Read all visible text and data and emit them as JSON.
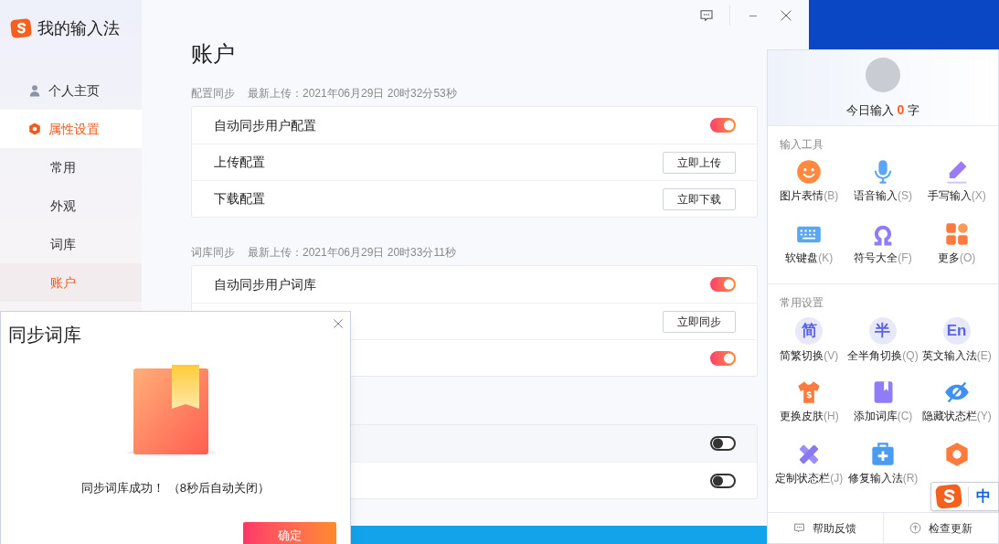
{
  "app": {
    "title": "我的输入法"
  },
  "title_bar": {
    "buttons": [
      {
        "kind": "feedback"
      },
      {
        "kind": "minimize"
      },
      {
        "kind": "close"
      }
    ]
  },
  "sidebar": {
    "items": [
      {
        "label": "个人主页",
        "kind": "person",
        "selected": false
      },
      {
        "label": "属性设置",
        "kind": "hexagon",
        "selected": true,
        "children": [
          {
            "label": "常用",
            "selected": false
          },
          {
            "label": "外观",
            "selected": false
          },
          {
            "label": "词库",
            "selected": false
          },
          {
            "label": "账户",
            "selected": true
          }
        ]
      }
    ]
  },
  "page": {
    "title": "账户",
    "sections": [
      {
        "name": "配置同步",
        "note": "最新上传：2021年06月29日 20时32分53秒",
        "rows": [
          {
            "kind": "toggle",
            "label": "自动同步用户配置",
            "on": true
          },
          {
            "kind": "button",
            "label": "上传配置",
            "button": "立即上传"
          },
          {
            "kind": "button",
            "label": "下载配置",
            "button": "立即下载"
          }
        ]
      },
      {
        "name": "词库同步",
        "note": "最新上传：2021年06月29日 20时33分11秒",
        "rows": [
          {
            "kind": "toggle",
            "label": "自动同步用户词库",
            "on": true
          },
          {
            "kind": "button",
            "button": "立即同步"
          },
          {
            "kind": "toggle",
            "on": true
          }
        ]
      },
      {
        "rows": [
          {
            "kind": "toggle",
            "on": false,
            "hovered": true
          },
          {
            "kind": "toggle",
            "on": false
          }
        ]
      }
    ]
  },
  "dialog": {
    "title": "同步词库",
    "message": "同步词库成功！ （8秒后自动关闭）",
    "button": "确定"
  },
  "panel": {
    "today": {
      "prefix": "今日输入",
      "count": "0",
      "suffix": "字"
    },
    "groups": [
      {
        "title": "输入工具",
        "items": [
          {
            "kind": "smile",
            "label": "图片表情",
            "key": "(B)"
          },
          {
            "kind": "mic",
            "label": "语音输入",
            "key": "(S)"
          },
          {
            "kind": "pen",
            "label": "手写输入",
            "key": "(X)"
          },
          {
            "kind": "keyboard",
            "label": "软键盘",
            "key": "(K)"
          },
          {
            "kind": "omega",
            "label": "符号大全",
            "key": "(F)"
          },
          {
            "kind": "grid",
            "label": "更多",
            "key": "(O)"
          }
        ]
      },
      {
        "title": "常用设置",
        "items": [
          {
            "kind": "glyph",
            "glyph": "简",
            "label": "简繁切换",
            "key": "(V)"
          },
          {
            "kind": "glyph",
            "glyph": "半",
            "label": "全半角切换",
            "key": "(Q)"
          },
          {
            "kind": "glyph",
            "glyph": "En",
            "label": "英文输入法",
            "key": "(E)"
          },
          {
            "kind": "shirt",
            "label": "更换皮肤",
            "key": "(H)"
          },
          {
            "kind": "book",
            "label": "添加词库",
            "key": "(C)"
          },
          {
            "kind": "eye",
            "label": "隐藏状态栏",
            "key": "(Y)"
          },
          {
            "kind": "ruler",
            "label": "定制状态栏",
            "key": "(J)"
          },
          {
            "kind": "kit",
            "label": "修复输入法",
            "key": "(R)"
          },
          {
            "kind": "hexagon"
          }
        ]
      }
    ],
    "footer": [
      {
        "kind": "feedback",
        "label": "帮助反馈"
      },
      {
        "kind": "update",
        "label": "检查更新"
      }
    ]
  },
  "status_bar": {
    "mode": "中"
  }
}
